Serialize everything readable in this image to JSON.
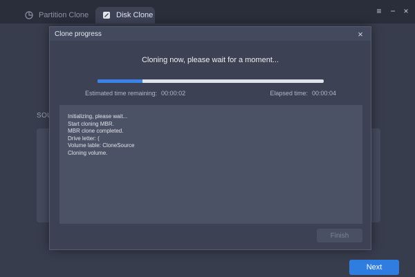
{
  "tabs": [
    {
      "label": "Partition Clone",
      "icon": "pie-chart-icon",
      "active": false
    },
    {
      "label": "Disk Clone",
      "icon": "disk-icon",
      "active": true
    }
  ],
  "window_controls": {
    "menu": "≡",
    "minimize": "−",
    "close": "×"
  },
  "main": {
    "section_label": "SOU",
    "next_label": "Next"
  },
  "dialog": {
    "title": "Clone progress",
    "close": "×",
    "status": "Cloning now, please wait for a moment...",
    "progress_percent": 20,
    "estimated_label": "Estimated time remaining:",
    "estimated_value": "00:00:02",
    "elapsed_label": "Elapsed time:",
    "elapsed_value": "00:00:04",
    "log": [
      "Initializing, please wait...",
      "Start cloning MBR.",
      "MBR clone completed.",
      "Drive letter: (",
      "Volume lable: CloneSource",
      "Cloning volume."
    ],
    "finish_label": "Finish"
  },
  "colors": {
    "accent": "#3b82e8",
    "background": "#2d3140"
  }
}
